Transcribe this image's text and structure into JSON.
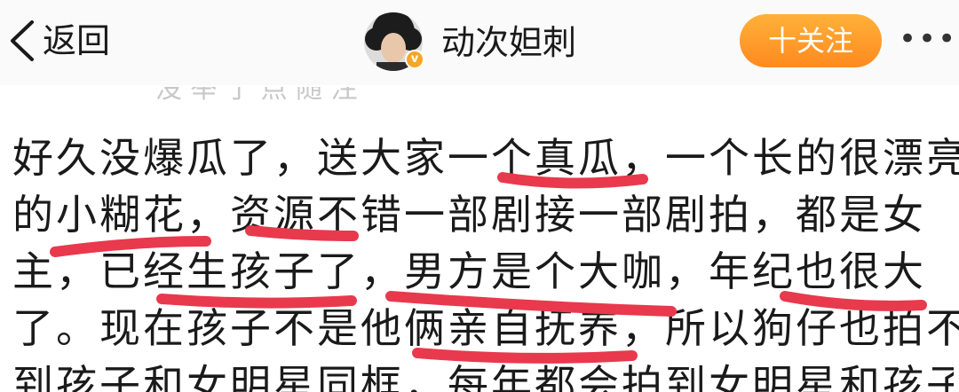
{
  "header": {
    "back_label": "返回",
    "username": "动次妲刺",
    "follow_label": "十关注",
    "more_label": "•••",
    "faded_text": "没 举 了 点 随 注"
  },
  "post": {
    "lines": [
      "好久没爆瓜了，送大家一个真瓜，一个长的很漂亮",
      "的小糊花，资源不错一部剧接一部剧拍，都是女",
      "主，已经生孩子了，男方是个大咖，年纪也很大",
      "了。现在孩子不是他俩亲自抚养，所以狗仔也拍不",
      "到孩子和女明星同框，每年都会拍到女明星和孩子"
    ]
  },
  "colors": {
    "underline": "#e8394d",
    "follow": "#ff9a2a",
    "verified": "#f5a623"
  }
}
